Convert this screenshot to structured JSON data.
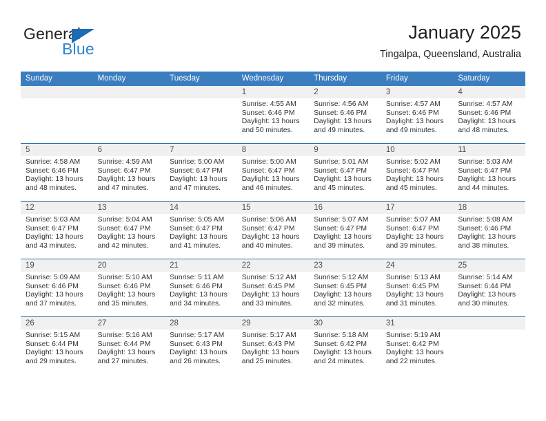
{
  "brand": {
    "name_top": "General",
    "name_bottom": "Blue",
    "triangle_color": "#1b6cb5",
    "blue_text_color": "#2b86d1"
  },
  "header": {
    "title": "January 2025",
    "subtitle": "Tingalpa, Queensland, Australia"
  },
  "theme": {
    "header_row_bg": "#3a7ec0",
    "daynum_band_bg": "#f0f0f0",
    "row_divider": "#2f6ca6"
  },
  "weekdays": [
    "Sunday",
    "Monday",
    "Tuesday",
    "Wednesday",
    "Thursday",
    "Friday",
    "Saturday"
  ],
  "labels": {
    "sunrise_prefix": "Sunrise:",
    "sunset_prefix": "Sunset:",
    "daylight_prefix": "Daylight:"
  },
  "weeks": [
    [
      {
        "day": "",
        "empty": true
      },
      {
        "day": "",
        "empty": true
      },
      {
        "day": "",
        "empty": true
      },
      {
        "day": "1",
        "sunrise": "Sunrise: 4:55 AM",
        "sunset": "Sunset: 6:46 PM",
        "daylight1": "Daylight: 13 hours",
        "daylight2": "and 50 minutes."
      },
      {
        "day": "2",
        "sunrise": "Sunrise: 4:56 AM",
        "sunset": "Sunset: 6:46 PM",
        "daylight1": "Daylight: 13 hours",
        "daylight2": "and 49 minutes."
      },
      {
        "day": "3",
        "sunrise": "Sunrise: 4:57 AM",
        "sunset": "Sunset: 6:46 PM",
        "daylight1": "Daylight: 13 hours",
        "daylight2": "and 49 minutes."
      },
      {
        "day": "4",
        "sunrise": "Sunrise: 4:57 AM",
        "sunset": "Sunset: 6:46 PM",
        "daylight1": "Daylight: 13 hours",
        "daylight2": "and 48 minutes."
      }
    ],
    [
      {
        "day": "5",
        "sunrise": "Sunrise: 4:58 AM",
        "sunset": "Sunset: 6:46 PM",
        "daylight1": "Daylight: 13 hours",
        "daylight2": "and 48 minutes."
      },
      {
        "day": "6",
        "sunrise": "Sunrise: 4:59 AM",
        "sunset": "Sunset: 6:47 PM",
        "daylight1": "Daylight: 13 hours",
        "daylight2": "and 47 minutes."
      },
      {
        "day": "7",
        "sunrise": "Sunrise: 5:00 AM",
        "sunset": "Sunset: 6:47 PM",
        "daylight1": "Daylight: 13 hours",
        "daylight2": "and 47 minutes."
      },
      {
        "day": "8",
        "sunrise": "Sunrise: 5:00 AM",
        "sunset": "Sunset: 6:47 PM",
        "daylight1": "Daylight: 13 hours",
        "daylight2": "and 46 minutes."
      },
      {
        "day": "9",
        "sunrise": "Sunrise: 5:01 AM",
        "sunset": "Sunset: 6:47 PM",
        "daylight1": "Daylight: 13 hours",
        "daylight2": "and 45 minutes."
      },
      {
        "day": "10",
        "sunrise": "Sunrise: 5:02 AM",
        "sunset": "Sunset: 6:47 PM",
        "daylight1": "Daylight: 13 hours",
        "daylight2": "and 45 minutes."
      },
      {
        "day": "11",
        "sunrise": "Sunrise: 5:03 AM",
        "sunset": "Sunset: 6:47 PM",
        "daylight1": "Daylight: 13 hours",
        "daylight2": "and 44 minutes."
      }
    ],
    [
      {
        "day": "12",
        "sunrise": "Sunrise: 5:03 AM",
        "sunset": "Sunset: 6:47 PM",
        "daylight1": "Daylight: 13 hours",
        "daylight2": "and 43 minutes."
      },
      {
        "day": "13",
        "sunrise": "Sunrise: 5:04 AM",
        "sunset": "Sunset: 6:47 PM",
        "daylight1": "Daylight: 13 hours",
        "daylight2": "and 42 minutes."
      },
      {
        "day": "14",
        "sunrise": "Sunrise: 5:05 AM",
        "sunset": "Sunset: 6:47 PM",
        "daylight1": "Daylight: 13 hours",
        "daylight2": "and 41 minutes."
      },
      {
        "day": "15",
        "sunrise": "Sunrise: 5:06 AM",
        "sunset": "Sunset: 6:47 PM",
        "daylight1": "Daylight: 13 hours",
        "daylight2": "and 40 minutes."
      },
      {
        "day": "16",
        "sunrise": "Sunrise: 5:07 AM",
        "sunset": "Sunset: 6:47 PM",
        "daylight1": "Daylight: 13 hours",
        "daylight2": "and 39 minutes."
      },
      {
        "day": "17",
        "sunrise": "Sunrise: 5:07 AM",
        "sunset": "Sunset: 6:47 PM",
        "daylight1": "Daylight: 13 hours",
        "daylight2": "and 39 minutes."
      },
      {
        "day": "18",
        "sunrise": "Sunrise: 5:08 AM",
        "sunset": "Sunset: 6:46 PM",
        "daylight1": "Daylight: 13 hours",
        "daylight2": "and 38 minutes."
      }
    ],
    [
      {
        "day": "19",
        "sunrise": "Sunrise: 5:09 AM",
        "sunset": "Sunset: 6:46 PM",
        "daylight1": "Daylight: 13 hours",
        "daylight2": "and 37 minutes."
      },
      {
        "day": "20",
        "sunrise": "Sunrise: 5:10 AM",
        "sunset": "Sunset: 6:46 PM",
        "daylight1": "Daylight: 13 hours",
        "daylight2": "and 35 minutes."
      },
      {
        "day": "21",
        "sunrise": "Sunrise: 5:11 AM",
        "sunset": "Sunset: 6:46 PM",
        "daylight1": "Daylight: 13 hours",
        "daylight2": "and 34 minutes."
      },
      {
        "day": "22",
        "sunrise": "Sunrise: 5:12 AM",
        "sunset": "Sunset: 6:45 PM",
        "daylight1": "Daylight: 13 hours",
        "daylight2": "and 33 minutes."
      },
      {
        "day": "23",
        "sunrise": "Sunrise: 5:12 AM",
        "sunset": "Sunset: 6:45 PM",
        "daylight1": "Daylight: 13 hours",
        "daylight2": "and 32 minutes."
      },
      {
        "day": "24",
        "sunrise": "Sunrise: 5:13 AM",
        "sunset": "Sunset: 6:45 PM",
        "daylight1": "Daylight: 13 hours",
        "daylight2": "and 31 minutes."
      },
      {
        "day": "25",
        "sunrise": "Sunrise: 5:14 AM",
        "sunset": "Sunset: 6:44 PM",
        "daylight1": "Daylight: 13 hours",
        "daylight2": "and 30 minutes."
      }
    ],
    [
      {
        "day": "26",
        "sunrise": "Sunrise: 5:15 AM",
        "sunset": "Sunset: 6:44 PM",
        "daylight1": "Daylight: 13 hours",
        "daylight2": "and 29 minutes."
      },
      {
        "day": "27",
        "sunrise": "Sunrise: 5:16 AM",
        "sunset": "Sunset: 6:44 PM",
        "daylight1": "Daylight: 13 hours",
        "daylight2": "and 27 minutes."
      },
      {
        "day": "28",
        "sunrise": "Sunrise: 5:17 AM",
        "sunset": "Sunset: 6:43 PM",
        "daylight1": "Daylight: 13 hours",
        "daylight2": "and 26 minutes."
      },
      {
        "day": "29",
        "sunrise": "Sunrise: 5:17 AM",
        "sunset": "Sunset: 6:43 PM",
        "daylight1": "Daylight: 13 hours",
        "daylight2": "and 25 minutes."
      },
      {
        "day": "30",
        "sunrise": "Sunrise: 5:18 AM",
        "sunset": "Sunset: 6:42 PM",
        "daylight1": "Daylight: 13 hours",
        "daylight2": "and 24 minutes."
      },
      {
        "day": "31",
        "sunrise": "Sunrise: 5:19 AM",
        "sunset": "Sunset: 6:42 PM",
        "daylight1": "Daylight: 13 hours",
        "daylight2": "and 22 minutes."
      },
      {
        "day": "",
        "empty": true
      }
    ]
  ]
}
